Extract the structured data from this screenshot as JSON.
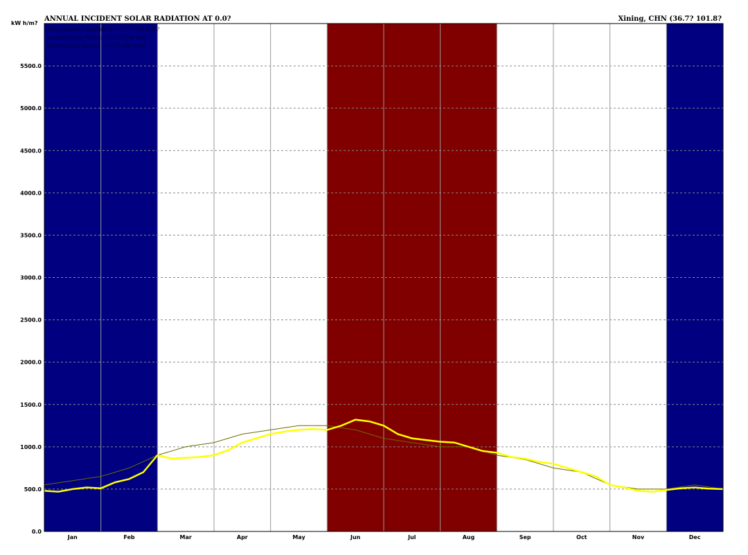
{
  "chart_data": {
    "type": "line",
    "title": "ANNUAL INCIDENT SOLAR RADIATION AT 0.0?",
    "location": "Xining, CHN (36.7? 101.8?",
    "ylabel": "kW h/m?",
    "ylim": [
      0,
      6000
    ],
    "yticks": [
      "0.0",
      "500.0",
      "1000.0",
      "1500.0",
      "2000.0",
      "2500.0",
      "3000.0",
      "3500.0",
      "4000.0",
      "4500.0",
      "5000.0",
      "5500.0"
    ],
    "months": [
      "Jan",
      "Feb",
      "Mar",
      "Apr",
      "May",
      "Jun",
      "Jul",
      "Aug",
      "Sep",
      "Oct",
      "Nov",
      "Dec"
    ],
    "season_bands": [
      {
        "season": "winter",
        "months": [
          "Dec",
          "Jan",
          "Feb"
        ],
        "color": "#000080"
      },
      {
        "season": "summer",
        "months": [
          "Jun",
          "Jul",
          "Aug"
        ],
        "color": "#800000"
      }
    ],
    "grid": true,
    "legend_lines": [
      "Total Incident Radiation: ?????? kW h/m?",
      "Underheated Period: ?????? kW h/m?",
      "Overheated Period: ?????? kW h/m?"
    ],
    "series": [
      {
        "color": "#6b6b00",
        "x_months": [
          0.0,
          0.5,
          1.0,
          1.5,
          2.0,
          2.5,
          3.0,
          3.5,
          4.0,
          4.5,
          5.0,
          5.5,
          6.0,
          6.5,
          7.0,
          7.5,
          8.0,
          8.5,
          9.0,
          9.5,
          10.0,
          10.5,
          11.0,
          11.5,
          12.0
        ],
        "values": [
          550,
          600,
          650,
          750,
          900,
          1000,
          1050,
          1150,
          1200,
          1250,
          1250,
          1200,
          1100,
          1050,
          1000,
          1000,
          900,
          850,
          750,
          700,
          550,
          500,
          500,
          550,
          500
        ]
      },
      {
        "color": "#ffff00",
        "x_months": [
          0.0,
          0.25,
          0.5,
          0.75,
          1.0,
          1.25,
          1.5,
          1.75,
          2.0,
          2.25,
          2.5,
          2.75,
          3.0,
          3.25,
          3.5,
          3.75,
          4.0,
          4.25,
          4.5,
          4.75,
          5.0,
          5.25,
          5.5,
          5.75,
          6.0,
          6.25,
          6.5,
          6.75,
          7.0,
          7.25,
          7.5,
          7.75,
          8.0,
          8.25,
          8.5,
          8.75,
          9.0,
          9.25,
          9.5,
          9.75,
          10.0,
          10.25,
          10.5,
          10.75,
          11.0,
          11.25,
          11.5,
          11.75,
          12.0
        ],
        "values": [
          480,
          470,
          500,
          520,
          510,
          580,
          620,
          700,
          900,
          860,
          870,
          880,
          900,
          960,
          1050,
          1100,
          1150,
          1180,
          1200,
          1210,
          1200,
          1250,
          1320,
          1300,
          1250,
          1150,
          1100,
          1080,
          1060,
          1050,
          1000,
          950,
          930,
          880,
          860,
          820,
          800,
          750,
          700,
          650,
          550,
          520,
          480,
          470,
          490,
          510,
          520,
          505,
          500
        ]
      }
    ]
  }
}
